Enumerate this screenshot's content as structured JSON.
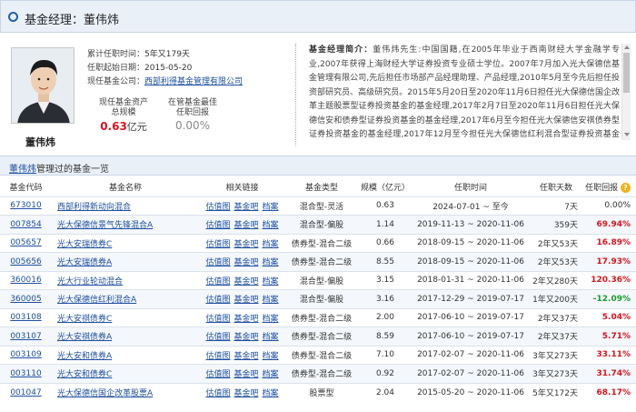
{
  "header": {
    "title": "基金经理：董伟炜"
  },
  "manager": {
    "name": "董伟炜",
    "tenure_label": "累计任职时间：",
    "tenure_value": "5年又179天",
    "start_label": "任职起始日期：",
    "start_value": "2015-05-20",
    "company_label": "现任基金公司：",
    "company_value": "西部利得基金管理有限公司",
    "aum_label_1": "现任基金资产",
    "aum_label_2": "总规模",
    "aum_value": "0.63",
    "aum_unit": "亿元",
    "best_label_1": "在管基金最佳",
    "best_label_2": "任职回报",
    "best_value": "0.00%"
  },
  "intro": {
    "label": "基金经理简介：",
    "text": "董伟炜先生:中国国籍,在2005年毕业于西南财经大学金融学专业,2007年获得上海财经大学证券投资专业硕士学位。2007年7月加入光大保德信基金管理有限公司,先后担任市场部产品经理助理、产品经理,2010年5月至今先后担任投资部研究员、高级研究员。2015年5月20日至2020年11月6日担任光大保德信国企改革主题股票型证券投资基金的基金经理,2017年2月7日至2020年11月6日担任光大保德信安和债券型证券投资基金的基金经理,2017年6月至今担任光大保德信安祺债券型证券投资基金的基金经理,2017年12月至今担任光大保德信红利混合型证券投资基金的基金经理,2018年1月至2020年11月6日担任光大保德信行业轮动混合型证券投资基金的基金经理。"
  },
  "fund_list": {
    "manager_link": "董伟炜",
    "title_suffix": "管理过的基金一览",
    "columns": [
      "基金代码",
      "基金名称",
      "相关链接",
      "基金类型",
      "规模（亿元）",
      "任职时间",
      "任职天数",
      "任职回报"
    ],
    "links": [
      "估值图",
      "基金吧",
      "档案"
    ],
    "help": "?",
    "rows": [
      {
        "code": "673010",
        "name": "西部利得新动向混合",
        "type": "混合型-灵活",
        "size": "0.63",
        "period": "2024-07-01 ~ 至今",
        "days": "7天",
        "ret": "0.00%",
        "sign": "zero"
      },
      {
        "code": "007854",
        "name": "光大保德信景气先锋混合A",
        "type": "混合型-偏股",
        "size": "1.14",
        "period": "2019-11-13 ~ 2020-11-06",
        "days": "359天",
        "ret": "69.94%",
        "sign": "pos"
      },
      {
        "code": "005657",
        "name": "光大安瑞债券C",
        "type": "债券型-混合二级",
        "size": "0.66",
        "period": "2018-09-15 ~ 2020-11-06",
        "days": "2年又53天",
        "ret": "16.89%",
        "sign": "pos"
      },
      {
        "code": "005656",
        "name": "光大安瑞债券A",
        "type": "债券型-混合二级",
        "size": "8.55",
        "period": "2018-09-15 ~ 2020-11-06",
        "days": "2年又53天",
        "ret": "17.93%",
        "sign": "pos"
      },
      {
        "code": "360016",
        "name": "光大行业轮动混合",
        "type": "混合型-偏股",
        "size": "3.15",
        "period": "2018-01-31 ~ 2020-11-06",
        "days": "2年又280天",
        "ret": "120.36%",
        "sign": "pos"
      },
      {
        "code": "360005",
        "name": "光大保德信红利混合A",
        "type": "混合型-偏股",
        "size": "3.16",
        "period": "2017-12-29 ~ 2019-07-17",
        "days": "1年又200天",
        "ret": "-12.09%",
        "sign": "neg"
      },
      {
        "code": "003108",
        "name": "光大安祺债券C",
        "type": "债券型-混合二级",
        "size": "2.00",
        "period": "2017-06-10 ~ 2019-07-17",
        "days": "2年又37天",
        "ret": "5.04%",
        "sign": "pos"
      },
      {
        "code": "003107",
        "name": "光大安祺债券A",
        "type": "债券型-混合二级",
        "size": "8.59",
        "period": "2017-06-10 ~ 2019-07-17",
        "days": "2年又37天",
        "ret": "5.71%",
        "sign": "pos"
      },
      {
        "code": "003109",
        "name": "光大安和债券A",
        "type": "债券型-混合二级",
        "size": "7.10",
        "period": "2017-02-07 ~ 2020-11-06",
        "days": "3年又273天",
        "ret": "33.11%",
        "sign": "pos"
      },
      {
        "code": "003110",
        "name": "光大安和债券C",
        "type": "债券型-混合二级",
        "size": "0.92",
        "period": "2017-02-07 ~ 2020-11-06",
        "days": "3年又273天",
        "ret": "31.74%",
        "sign": "pos"
      },
      {
        "code": "001047",
        "name": "光大保德信国企改革股票A",
        "type": "股票型",
        "size": "2.04",
        "period": "2015-05-20 ~ 2020-11-06",
        "days": "5年又172天",
        "ret": "68.17%",
        "sign": "pos"
      }
    ]
  }
}
